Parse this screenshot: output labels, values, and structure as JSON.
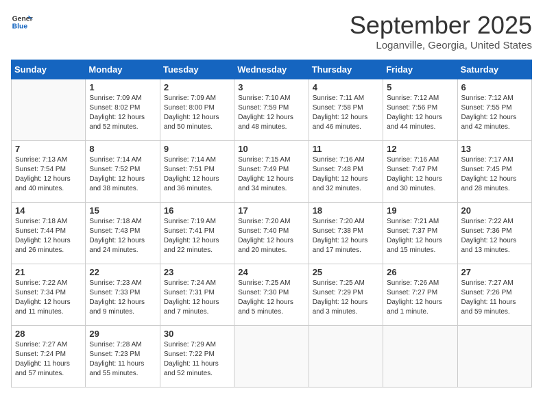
{
  "header": {
    "logo_general": "General",
    "logo_blue": "Blue",
    "month_title": "September 2025",
    "location": "Loganville, Georgia, United States"
  },
  "days_of_week": [
    "Sunday",
    "Monday",
    "Tuesday",
    "Wednesday",
    "Thursday",
    "Friday",
    "Saturday"
  ],
  "weeks": [
    [
      {
        "day": "",
        "lines": []
      },
      {
        "day": "1",
        "lines": [
          "Sunrise: 7:09 AM",
          "Sunset: 8:02 PM",
          "Daylight: 12 hours",
          "and 52 minutes."
        ]
      },
      {
        "day": "2",
        "lines": [
          "Sunrise: 7:09 AM",
          "Sunset: 8:00 PM",
          "Daylight: 12 hours",
          "and 50 minutes."
        ]
      },
      {
        "day": "3",
        "lines": [
          "Sunrise: 7:10 AM",
          "Sunset: 7:59 PM",
          "Daylight: 12 hours",
          "and 48 minutes."
        ]
      },
      {
        "day": "4",
        "lines": [
          "Sunrise: 7:11 AM",
          "Sunset: 7:58 PM",
          "Daylight: 12 hours",
          "and 46 minutes."
        ]
      },
      {
        "day": "5",
        "lines": [
          "Sunrise: 7:12 AM",
          "Sunset: 7:56 PM",
          "Daylight: 12 hours",
          "and 44 minutes."
        ]
      },
      {
        "day": "6",
        "lines": [
          "Sunrise: 7:12 AM",
          "Sunset: 7:55 PM",
          "Daylight: 12 hours",
          "and 42 minutes."
        ]
      }
    ],
    [
      {
        "day": "7",
        "lines": [
          "Sunrise: 7:13 AM",
          "Sunset: 7:54 PM",
          "Daylight: 12 hours",
          "and 40 minutes."
        ]
      },
      {
        "day": "8",
        "lines": [
          "Sunrise: 7:14 AM",
          "Sunset: 7:52 PM",
          "Daylight: 12 hours",
          "and 38 minutes."
        ]
      },
      {
        "day": "9",
        "lines": [
          "Sunrise: 7:14 AM",
          "Sunset: 7:51 PM",
          "Daylight: 12 hours",
          "and 36 minutes."
        ]
      },
      {
        "day": "10",
        "lines": [
          "Sunrise: 7:15 AM",
          "Sunset: 7:49 PM",
          "Daylight: 12 hours",
          "and 34 minutes."
        ]
      },
      {
        "day": "11",
        "lines": [
          "Sunrise: 7:16 AM",
          "Sunset: 7:48 PM",
          "Daylight: 12 hours",
          "and 32 minutes."
        ]
      },
      {
        "day": "12",
        "lines": [
          "Sunrise: 7:16 AM",
          "Sunset: 7:47 PM",
          "Daylight: 12 hours",
          "and 30 minutes."
        ]
      },
      {
        "day": "13",
        "lines": [
          "Sunrise: 7:17 AM",
          "Sunset: 7:45 PM",
          "Daylight: 12 hours",
          "and 28 minutes."
        ]
      }
    ],
    [
      {
        "day": "14",
        "lines": [
          "Sunrise: 7:18 AM",
          "Sunset: 7:44 PM",
          "Daylight: 12 hours",
          "and 26 minutes."
        ]
      },
      {
        "day": "15",
        "lines": [
          "Sunrise: 7:18 AM",
          "Sunset: 7:43 PM",
          "Daylight: 12 hours",
          "and 24 minutes."
        ]
      },
      {
        "day": "16",
        "lines": [
          "Sunrise: 7:19 AM",
          "Sunset: 7:41 PM",
          "Daylight: 12 hours",
          "and 22 minutes."
        ]
      },
      {
        "day": "17",
        "lines": [
          "Sunrise: 7:20 AM",
          "Sunset: 7:40 PM",
          "Daylight: 12 hours",
          "and 20 minutes."
        ]
      },
      {
        "day": "18",
        "lines": [
          "Sunrise: 7:20 AM",
          "Sunset: 7:38 PM",
          "Daylight: 12 hours",
          "and 17 minutes."
        ]
      },
      {
        "day": "19",
        "lines": [
          "Sunrise: 7:21 AM",
          "Sunset: 7:37 PM",
          "Daylight: 12 hours",
          "and 15 minutes."
        ]
      },
      {
        "day": "20",
        "lines": [
          "Sunrise: 7:22 AM",
          "Sunset: 7:36 PM",
          "Daylight: 12 hours",
          "and 13 minutes."
        ]
      }
    ],
    [
      {
        "day": "21",
        "lines": [
          "Sunrise: 7:22 AM",
          "Sunset: 7:34 PM",
          "Daylight: 12 hours",
          "and 11 minutes."
        ]
      },
      {
        "day": "22",
        "lines": [
          "Sunrise: 7:23 AM",
          "Sunset: 7:33 PM",
          "Daylight: 12 hours",
          "and 9 minutes."
        ]
      },
      {
        "day": "23",
        "lines": [
          "Sunrise: 7:24 AM",
          "Sunset: 7:31 PM",
          "Daylight: 12 hours",
          "and 7 minutes."
        ]
      },
      {
        "day": "24",
        "lines": [
          "Sunrise: 7:25 AM",
          "Sunset: 7:30 PM",
          "Daylight: 12 hours",
          "and 5 minutes."
        ]
      },
      {
        "day": "25",
        "lines": [
          "Sunrise: 7:25 AM",
          "Sunset: 7:29 PM",
          "Daylight: 12 hours",
          "and 3 minutes."
        ]
      },
      {
        "day": "26",
        "lines": [
          "Sunrise: 7:26 AM",
          "Sunset: 7:27 PM",
          "Daylight: 12 hours",
          "and 1 minute."
        ]
      },
      {
        "day": "27",
        "lines": [
          "Sunrise: 7:27 AM",
          "Sunset: 7:26 PM",
          "Daylight: 11 hours",
          "and 59 minutes."
        ]
      }
    ],
    [
      {
        "day": "28",
        "lines": [
          "Sunrise: 7:27 AM",
          "Sunset: 7:24 PM",
          "Daylight: 11 hours",
          "and 57 minutes."
        ]
      },
      {
        "day": "29",
        "lines": [
          "Sunrise: 7:28 AM",
          "Sunset: 7:23 PM",
          "Daylight: 11 hours",
          "and 55 minutes."
        ]
      },
      {
        "day": "30",
        "lines": [
          "Sunrise: 7:29 AM",
          "Sunset: 7:22 PM",
          "Daylight: 11 hours",
          "and 52 minutes."
        ]
      },
      {
        "day": "",
        "lines": []
      },
      {
        "day": "",
        "lines": []
      },
      {
        "day": "",
        "lines": []
      },
      {
        "day": "",
        "lines": []
      }
    ]
  ]
}
